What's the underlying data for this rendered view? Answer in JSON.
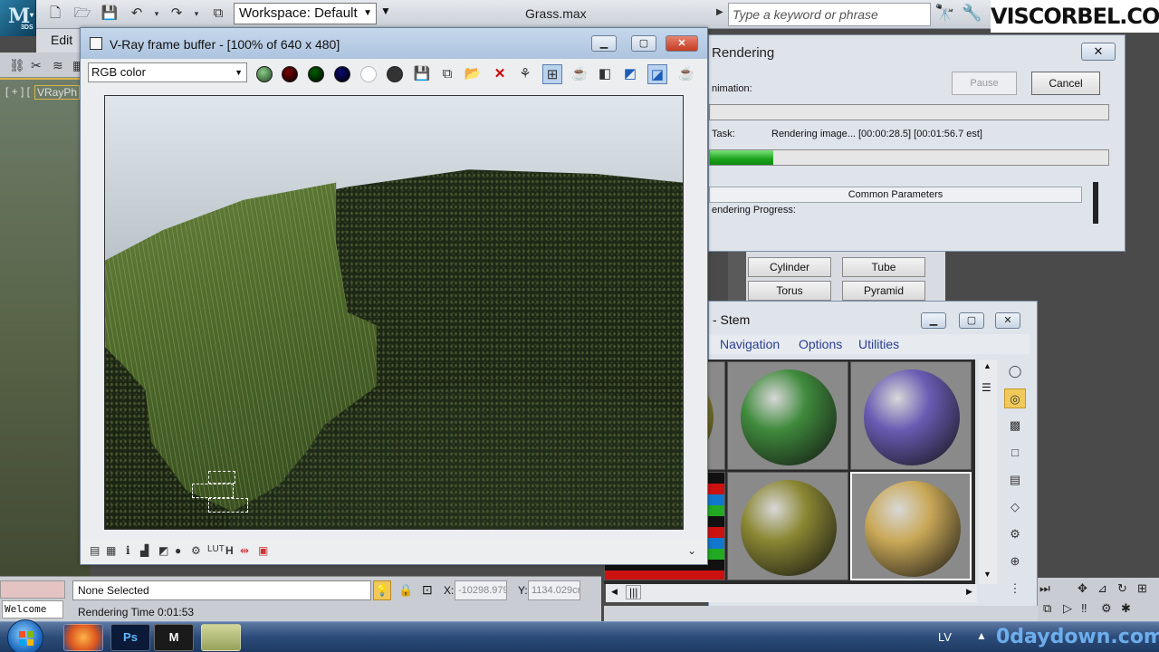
{
  "app": {
    "logo_text": "3DS",
    "workspace": "Workspace: Default",
    "filename": "Grass.max",
    "search_placeholder": "Type a keyword or phrase",
    "brand": "VISCORBEL.COM",
    "menu_edit": "Edit"
  },
  "viewport": {
    "label_a": "[ + ] [",
    "label_b": "VRayPh"
  },
  "vfb": {
    "title": "V-Ray frame buffer - [100% of 640 x 480]",
    "channel": "RGB color",
    "colors": {
      "red": "#7a0000",
      "green": "#006000",
      "blue": "#0a0a70"
    }
  },
  "render": {
    "title": "Rendering",
    "animation_label": "nimation:",
    "pause": "Pause",
    "cancel": "Cancel",
    "task_label": "Task:",
    "task_value": "Rendering image... [00:00:28.5] [00:01:56.7 est]",
    "progress_fraction": 0.16,
    "common_params": "Common Parameters",
    "progress_label": "endering Progress:"
  },
  "create": {
    "cylinder": "Cylinder",
    "tube": "Tube",
    "torus": "Torus",
    "pyramid": "Pyramid"
  },
  "material": {
    "title": "- Stem",
    "menu": {
      "navigation": "Navigation",
      "options": "Options",
      "utilities": "Utilities"
    },
    "sphere_colors": [
      "#3f8a3c",
      "#6a5bb3",
      "#8a8733",
      "#c9a857"
    ]
  },
  "status": {
    "welcome": "Welcome",
    "selection": "None Selected",
    "render_time": "Rendering Time  0:01:53",
    "x_label": "X:",
    "x_value": "-10298.979",
    "y_label": "Y:",
    "y_value": "1134.029cm"
  },
  "taskbar": {
    "lang": "LV",
    "watermark": "0daydown.com",
    "ps_label": "Ps"
  }
}
